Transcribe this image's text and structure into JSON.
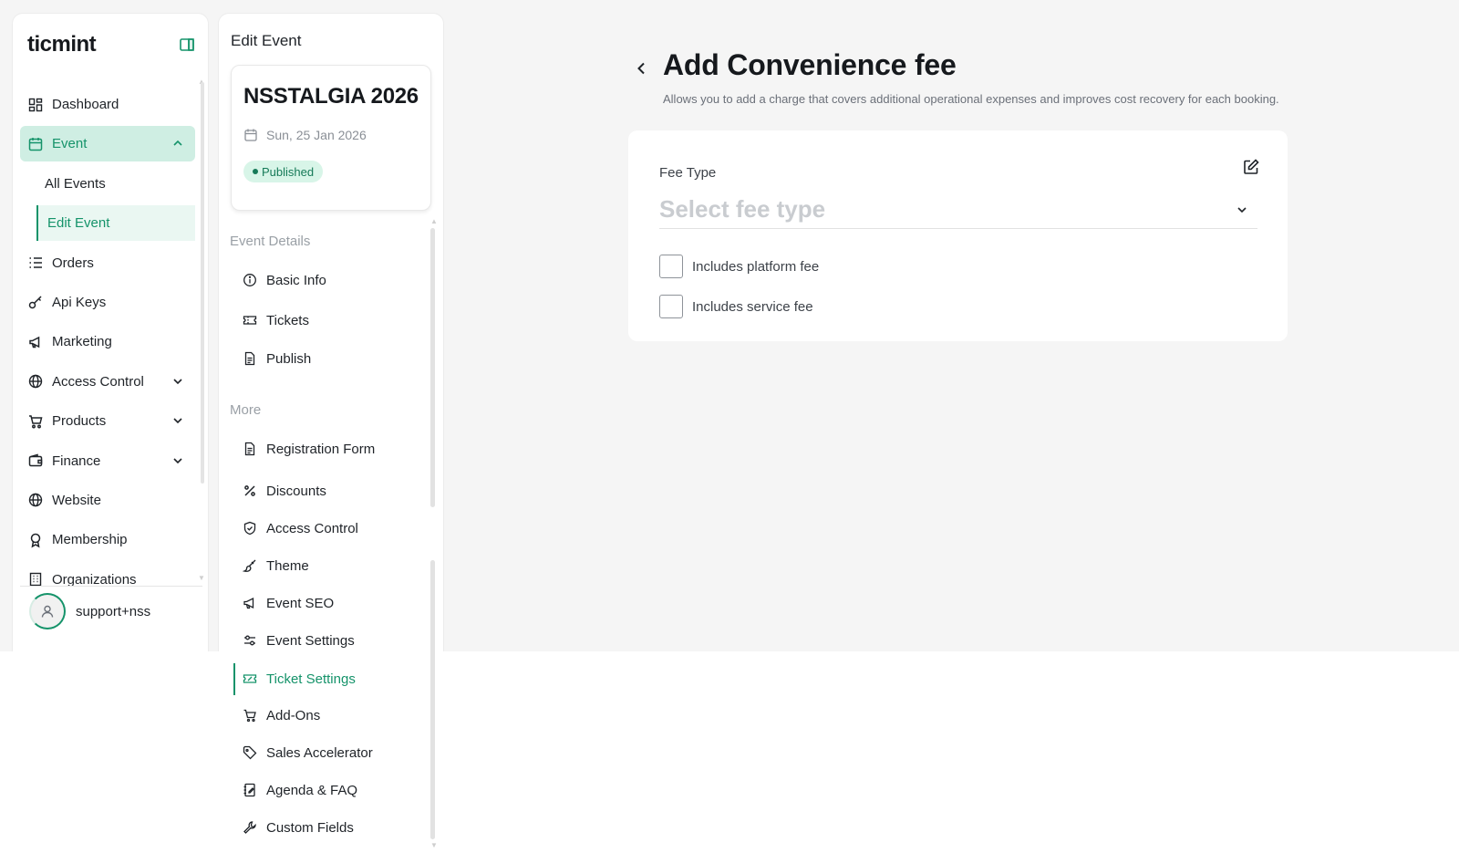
{
  "app": {
    "logo": "ticmint"
  },
  "sidebar": {
    "items": [
      {
        "label": "Dashboard",
        "icon": "dashboard-icon"
      },
      {
        "label": "Event",
        "icon": "calendar-icon",
        "active": true,
        "expanded": true,
        "children": [
          {
            "label": "All Events"
          },
          {
            "label": "Edit Event",
            "active": true
          }
        ]
      },
      {
        "label": "Orders",
        "icon": "list-icon"
      },
      {
        "label": "Api Keys",
        "icon": "key-icon"
      },
      {
        "label": "Marketing",
        "icon": "megaphone-icon"
      },
      {
        "label": "Access Control",
        "icon": "globe-lock-icon",
        "has_children": true
      },
      {
        "label": "Products",
        "icon": "cart-icon",
        "has_children": true
      },
      {
        "label": "Finance",
        "icon": "wallet-icon",
        "has_children": true
      },
      {
        "label": "Website",
        "icon": "globe-icon"
      },
      {
        "label": "Membership",
        "icon": "award-icon"
      },
      {
        "label": "Organizations",
        "icon": "building-icon"
      }
    ],
    "user": {
      "name": "support+nss"
    }
  },
  "edit_event": {
    "title": "Edit Event",
    "event": {
      "name": "NSSTALGIA 2026",
      "date": "Sun, 25 Jan 2026",
      "status": "Published"
    },
    "sections": [
      {
        "label": "Event Details",
        "items": [
          {
            "label": "Basic Info",
            "icon": "info-icon"
          },
          {
            "label": "Tickets",
            "icon": "ticket-icon"
          },
          {
            "label": "Publish",
            "icon": "file-icon"
          }
        ]
      },
      {
        "label": "More",
        "items": [
          {
            "label": "Registration Form",
            "icon": "document-icon"
          },
          {
            "label": "Discounts",
            "icon": "percent-icon"
          },
          {
            "label": "Access Control",
            "icon": "shield-icon"
          },
          {
            "label": "Theme",
            "icon": "brush-icon"
          },
          {
            "label": "Event SEO",
            "icon": "megaphone-icon"
          },
          {
            "label": "Event Settings",
            "icon": "sliders-icon"
          },
          {
            "label": "Ticket Settings",
            "icon": "ticket-settings-icon",
            "active": true
          },
          {
            "label": "Add-Ons",
            "icon": "cart-icon"
          },
          {
            "label": "Sales Accelerator",
            "icon": "tag-icon"
          },
          {
            "label": "Agenda & FAQ",
            "icon": "agenda-icon"
          },
          {
            "label": "Custom Fields",
            "icon": "wrench-icon"
          }
        ]
      }
    ]
  },
  "main": {
    "title": "Add Convenience fee",
    "subtitle": "Allows you to add a charge that covers additional operational expenses and improves cost recovery for each booking.",
    "fee_type_label": "Fee Type",
    "fee_type_placeholder": "Select fee type",
    "checkboxes": [
      {
        "label": "Includes platform fee",
        "checked": false
      },
      {
        "label": "Includes service fee",
        "checked": false
      }
    ]
  },
  "colors": {
    "accent": "#15936a",
    "accent_bg": "#cfeee3",
    "page_bg": "#f5f5f5"
  }
}
